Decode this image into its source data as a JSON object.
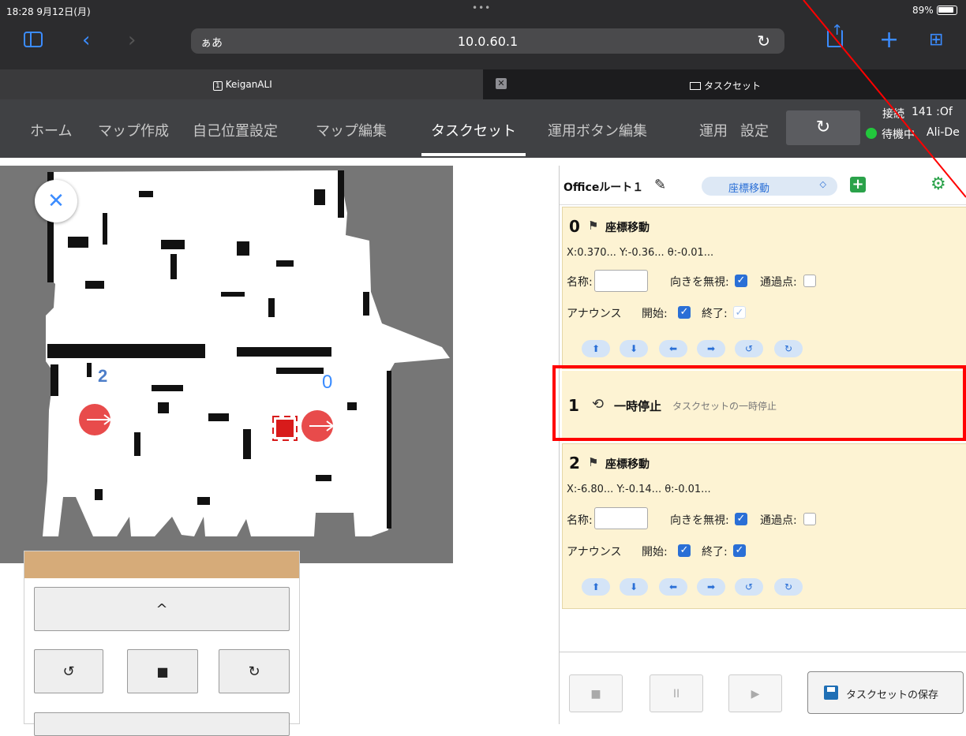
{
  "status_bar": {
    "time": "18:28  9月12日(月)",
    "dots": "•••",
    "battery": "89%"
  },
  "browser": {
    "address_aa": "ぁあ",
    "url": "10.0.60.1",
    "tabs": [
      {
        "label": "KeiganALI",
        "badge": "1"
      },
      {
        "label": "タスクセット"
      }
    ],
    "icons": [
      "sidebar-icon",
      "back-icon",
      "forward-icon",
      "reload-icon",
      "share-icon",
      "new-tab-icon",
      "tab-overview-icon"
    ]
  },
  "app_nav": {
    "items": [
      "ホーム",
      "マップ作成",
      "自己位置設定",
      "マップ編集",
      "タスクセット",
      "運用ボタン編集",
      "運用",
      "設定"
    ],
    "active_index": 4,
    "sync_icon": "↻",
    "connection": {
      "label": "接続",
      "count": "141 :Of",
      "status": "待機中",
      "device": "Ali-De"
    }
  },
  "map": {
    "close_glyph": "✕",
    "markers": [
      {
        "label": "2",
        "color": "#e84b4b"
      },
      {
        "label": "0",
        "color": "#e84b4b"
      }
    ]
  },
  "control_pad": {
    "forward": "^",
    "rotate_left": "↺",
    "stop": "■",
    "rotate_right": "↻"
  },
  "task_panel": {
    "route_name": "Officeルート１",
    "edit_icon": "✎",
    "task_type": "座標移動",
    "task_type_caret": "◇",
    "add_icon": "+",
    "settings_icon": "⚙",
    "tasks": [
      {
        "number": "0",
        "title": "座標移動",
        "coords": "X:0.370...  Y:-0.36...  θ:-0.01...",
        "name_label": "名称:",
        "ignore_dir_label": "向きを無視:",
        "waypoint_label": "通過点:",
        "announce_label": "アナウンス",
        "start_label": "開始:",
        "end_label": "終了:"
      },
      {
        "number": "1",
        "title": "一時停止",
        "description": "タスクセットの一時停止"
      },
      {
        "number": "2",
        "title": "座標移動",
        "coords": "X:-6.80...  Y:-0.14...  θ:-0.01...",
        "name_label": "名称:",
        "ignore_dir_label": "向きを無視:",
        "waypoint_label": "通過点:",
        "announce_label": "アナウンス",
        "start_label": "開始:",
        "end_label": "終了:"
      }
    ],
    "arrow_buttons": [
      "⬆",
      "⬇",
      "⬅",
      "➡",
      "↺",
      "↻"
    ],
    "bottom": {
      "stop": "■",
      "pause": "II",
      "play": "▶",
      "save": "タスクセットの保存"
    }
  }
}
